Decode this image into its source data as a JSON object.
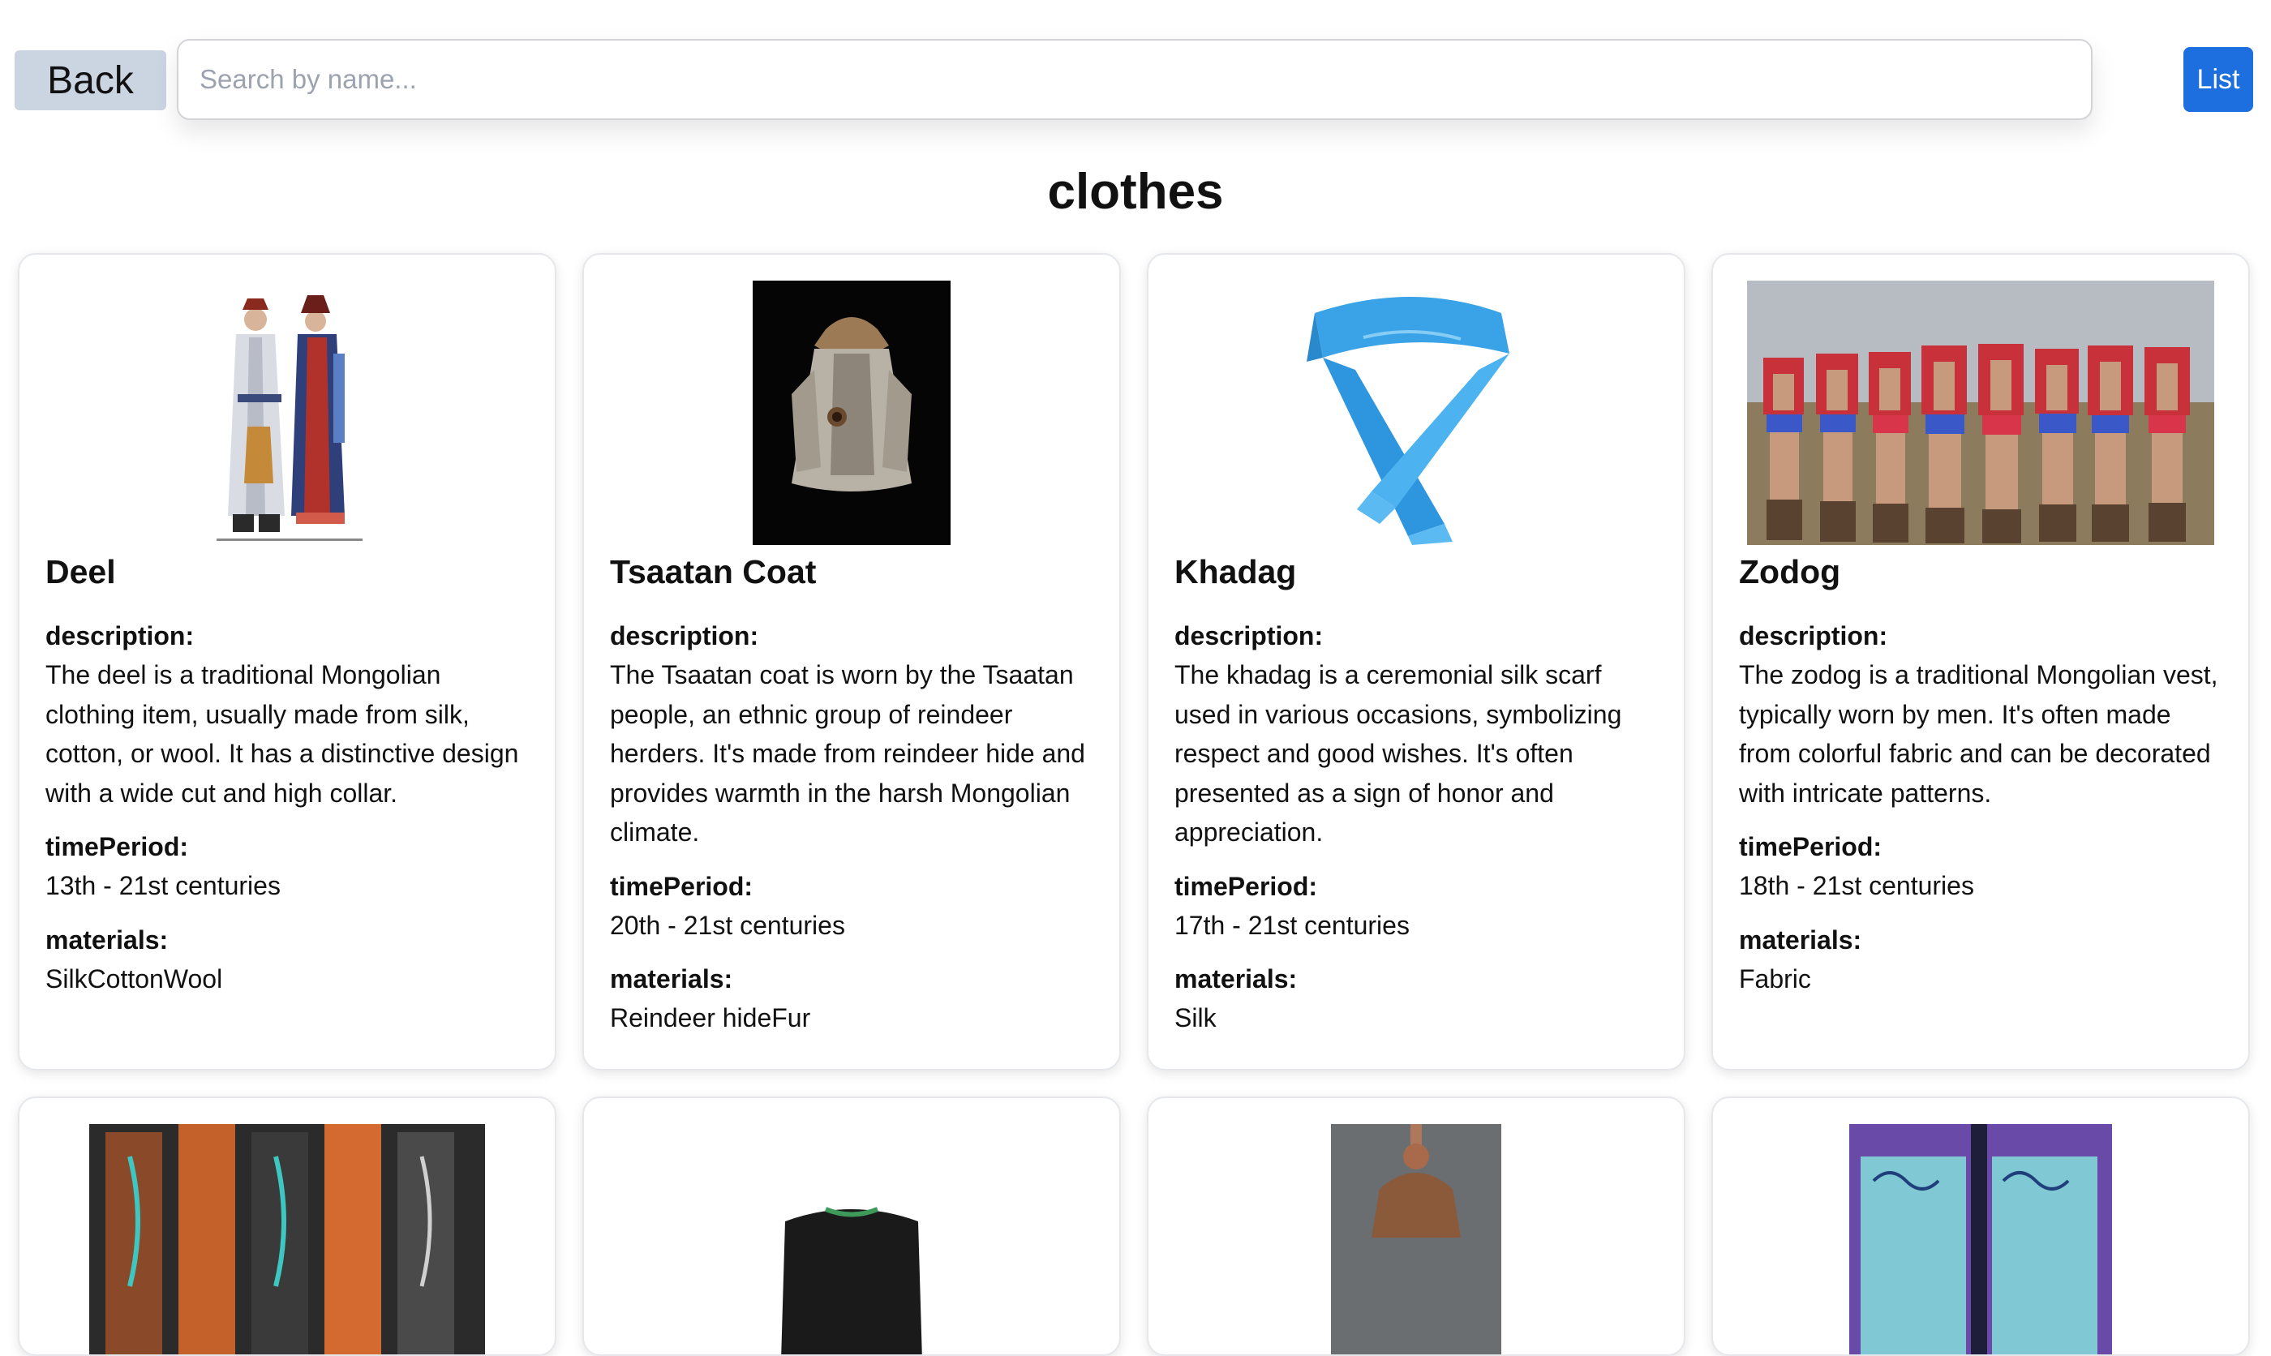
{
  "header": {
    "back_label": "Back",
    "search_placeholder": "Search by name...",
    "list_label": "List"
  },
  "page_title": "clothes",
  "labels": {
    "description": "description:",
    "time_period": "timePeriod:",
    "materials": "materials:"
  },
  "items": [
    {
      "name": "Deel",
      "image": "deel-costume-photo",
      "description": "The deel is a traditional Mongolian clothing item, usually made from silk, cotton, or wool. It has a distinctive design with a wide cut and high collar.",
      "timePeriod": "13th - 21st centuries",
      "materials": "SilkCottonWool"
    },
    {
      "name": "Tsaatan Coat",
      "image": "fur-coat-photo",
      "description": "The Tsaatan coat is worn by the Tsaatan people, an ethnic group of reindeer herders. It's made from reindeer hide and provides warmth in the harsh Mongolian climate.",
      "timePeriod": "20th - 21st centuries",
      "materials": "Reindeer hideFur"
    },
    {
      "name": "Khadag",
      "image": "blue-silk-scarf-photo",
      "description": "The khadag is a ceremonial silk scarf used in various occasions, symbolizing respect and good wishes. It's often presented as a sign of honor and appreciation.",
      "timePeriod": "17th - 21st centuries",
      "materials": "Silk"
    },
    {
      "name": "Zodog",
      "image": "wrestlers-photo",
      "description": "The zodog is a traditional Mongolian vest, typically worn by men. It's often made from colorful fabric and can be decorated with intricate patterns.",
      "timePeriod": "18th - 21st centuries",
      "materials": "Fabric"
    }
  ],
  "more_items_images": [
    "boots-photo",
    "dark-garment-photo",
    "hat-photo",
    "embroidered-fabric-photo"
  ]
}
